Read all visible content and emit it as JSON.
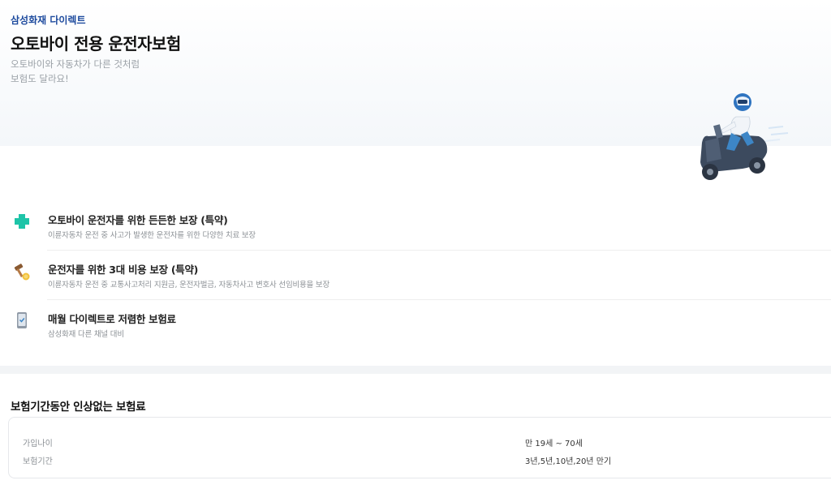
{
  "header": {
    "brand": "삼성화재 다이렉트",
    "title": "오토바이 전용 운전자보험",
    "subtitle_lines": [
      "오토바이와 자동차가 다른 것처럼",
      "보험도 달라요!"
    ]
  },
  "illustration": {
    "icon": "scooter-rider-illustration"
  },
  "features": [
    {
      "icon": "medical-cross-icon",
      "title": "오토바이 운전자를 위한 든든한 보장 (특약)",
      "desc": "이륜자동차 운전 중 사고가 발생한 운전자를 위한 다양한 치료 보장"
    },
    {
      "icon": "gavel-icon",
      "title": "운전자를 위한 3대 비용 보장 (특약)",
      "desc": "이륜자동차 운전 중 교통사고처리 지원금, 운전자벌금, 자동차사고 변호사 선임비용을 보장"
    },
    {
      "icon": "mobile-phone-icon",
      "title": "매월 다이렉트로 저렴한 보험료",
      "desc": "삼성화재 다른 채널 대비"
    }
  ],
  "premium_section": {
    "title": "보험기간동안 인상없는 보험료",
    "rows": [
      {
        "label": "가입나이",
        "value": "만 19세 ~ 70세"
      },
      {
        "label": "보험기간",
        "value": "3년,5년,10년,20년 만기"
      }
    ]
  },
  "colors": {
    "brand": "#1e4b9e",
    "accent_teal": "#1ec4a8"
  }
}
